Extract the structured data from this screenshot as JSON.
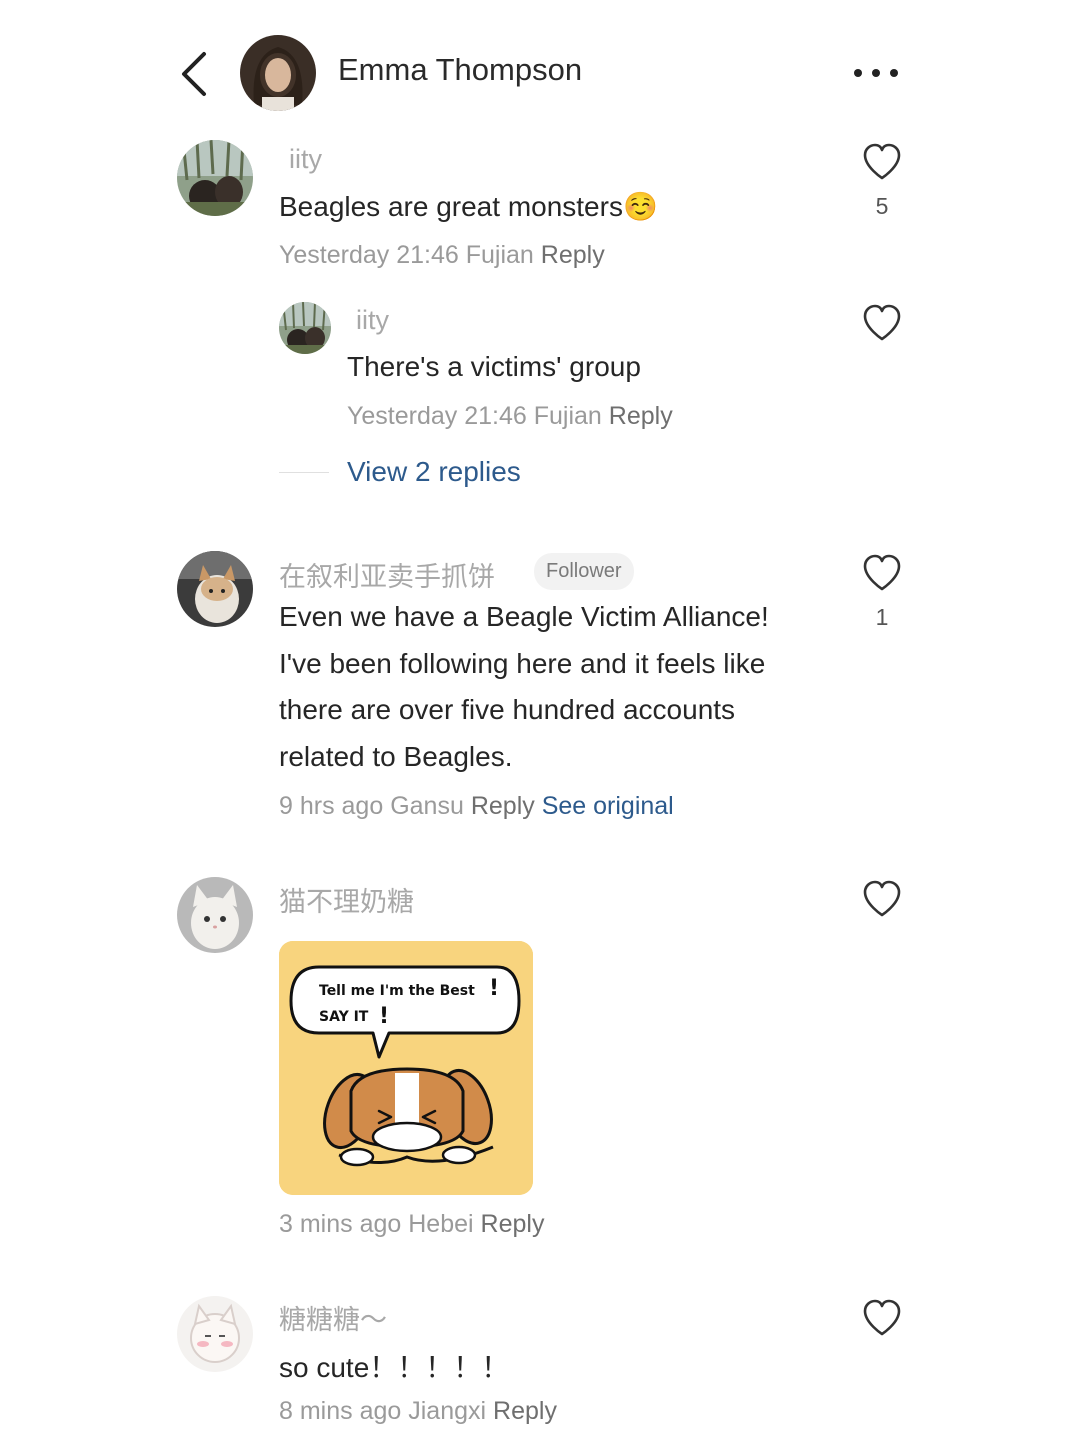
{
  "header": {
    "name": "Emma Thompson",
    "back_icon": "chevron-left-icon",
    "more_icon": "more-horizontal-icon"
  },
  "comments": [
    {
      "username": "iity",
      "text": "Beagles are great monsters",
      "emoji": "☺️",
      "time": "Yesterday 21:46",
      "location": "Fujian",
      "reply_label": "Reply",
      "likes": "5",
      "replies": [
        {
          "username": "iity",
          "text": "There's a victims' group",
          "time": "Yesterday 21:46",
          "location": "Fujian",
          "reply_label": "Reply"
        }
      ],
      "view_replies_label": "View 2 replies"
    },
    {
      "username": "在叙利亚卖手抓饼",
      "badge": "Follower",
      "lines": [
        "Even we have a Beagle Victim Alliance!",
        "I've been following here and it feels like",
        "there are over five hundred accounts",
        "related to Beagles."
      ],
      "time": "9 hrs ago",
      "location": "Gansu",
      "reply_label": "Reply",
      "see_original_label": "See original",
      "likes": "1"
    },
    {
      "username": "猫不理奶糖",
      "sticker": {
        "line1": "Tell me I'm the Best",
        "line2": "SAY IT",
        "bg_color": "#f8d47e"
      },
      "time": "3 mins ago",
      "location": "Hebei",
      "reply_label": "Reply"
    },
    {
      "username": "糖糖糖～",
      "text": "so cute！！！！！",
      "time": "8 mins ago",
      "location": "Jiangxi",
      "reply_label": "Reply"
    }
  ],
  "colors": {
    "link": "#2d5a8c",
    "muted": "#9a9a9a",
    "username": "#a8a8a8"
  }
}
